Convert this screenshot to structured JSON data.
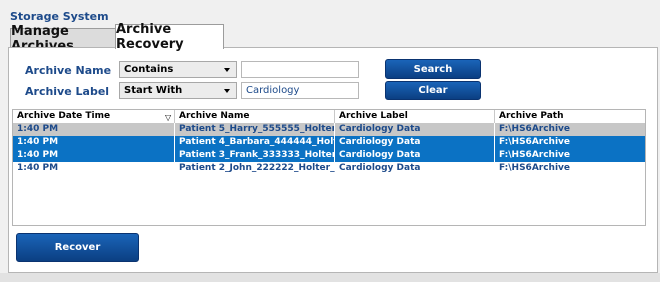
{
  "window": {
    "title": "Storage System"
  },
  "tabs": [
    {
      "label": "Manage Archives",
      "active": false
    },
    {
      "label": "Archive Recovery",
      "active": true
    }
  ],
  "search": {
    "name_label": "Archive Name",
    "name_mode": "Contains",
    "name_value": "",
    "label_label": "Archive Label",
    "label_mode": "Start With",
    "label_value": "Cardiology",
    "search_button": "Search",
    "clear_button": "Clear"
  },
  "table": {
    "columns": [
      "Archive Date Time",
      "Archive Name",
      "Archive Label",
      "Archive Path"
    ],
    "sort_icon": "sort-down-icon",
    "rows": [
      {
        "date": "1:40 PM",
        "name": "Patient 5_Harry_555555_Holter_...",
        "label": "Cardiology Data",
        "path": "F:\\HS6Archive",
        "state": "focused"
      },
      {
        "date": "1:40 PM",
        "name": "Patient 4_Barbara_444444_Holte...",
        "label": "Cardiology Data",
        "path": "F:\\HS6Archive",
        "state": "selected"
      },
      {
        "date": "1:40 PM",
        "name": "Patient 3_Frank_333333_Holter_...",
        "label": "Cardiology Data",
        "path": "F:\\HS6Archive",
        "state": "selected"
      },
      {
        "date": "1:40 PM",
        "name": "Patient 2_John_222222_Holter_...",
        "label": "Cardiology Data",
        "path": "F:\\HS6Archive",
        "state": "normal"
      }
    ]
  },
  "actions": {
    "recover_button": "Recover"
  },
  "colors": {
    "accent": "#0b72c4",
    "label_text": "#1d4a8a",
    "button": "#0b3f82"
  }
}
